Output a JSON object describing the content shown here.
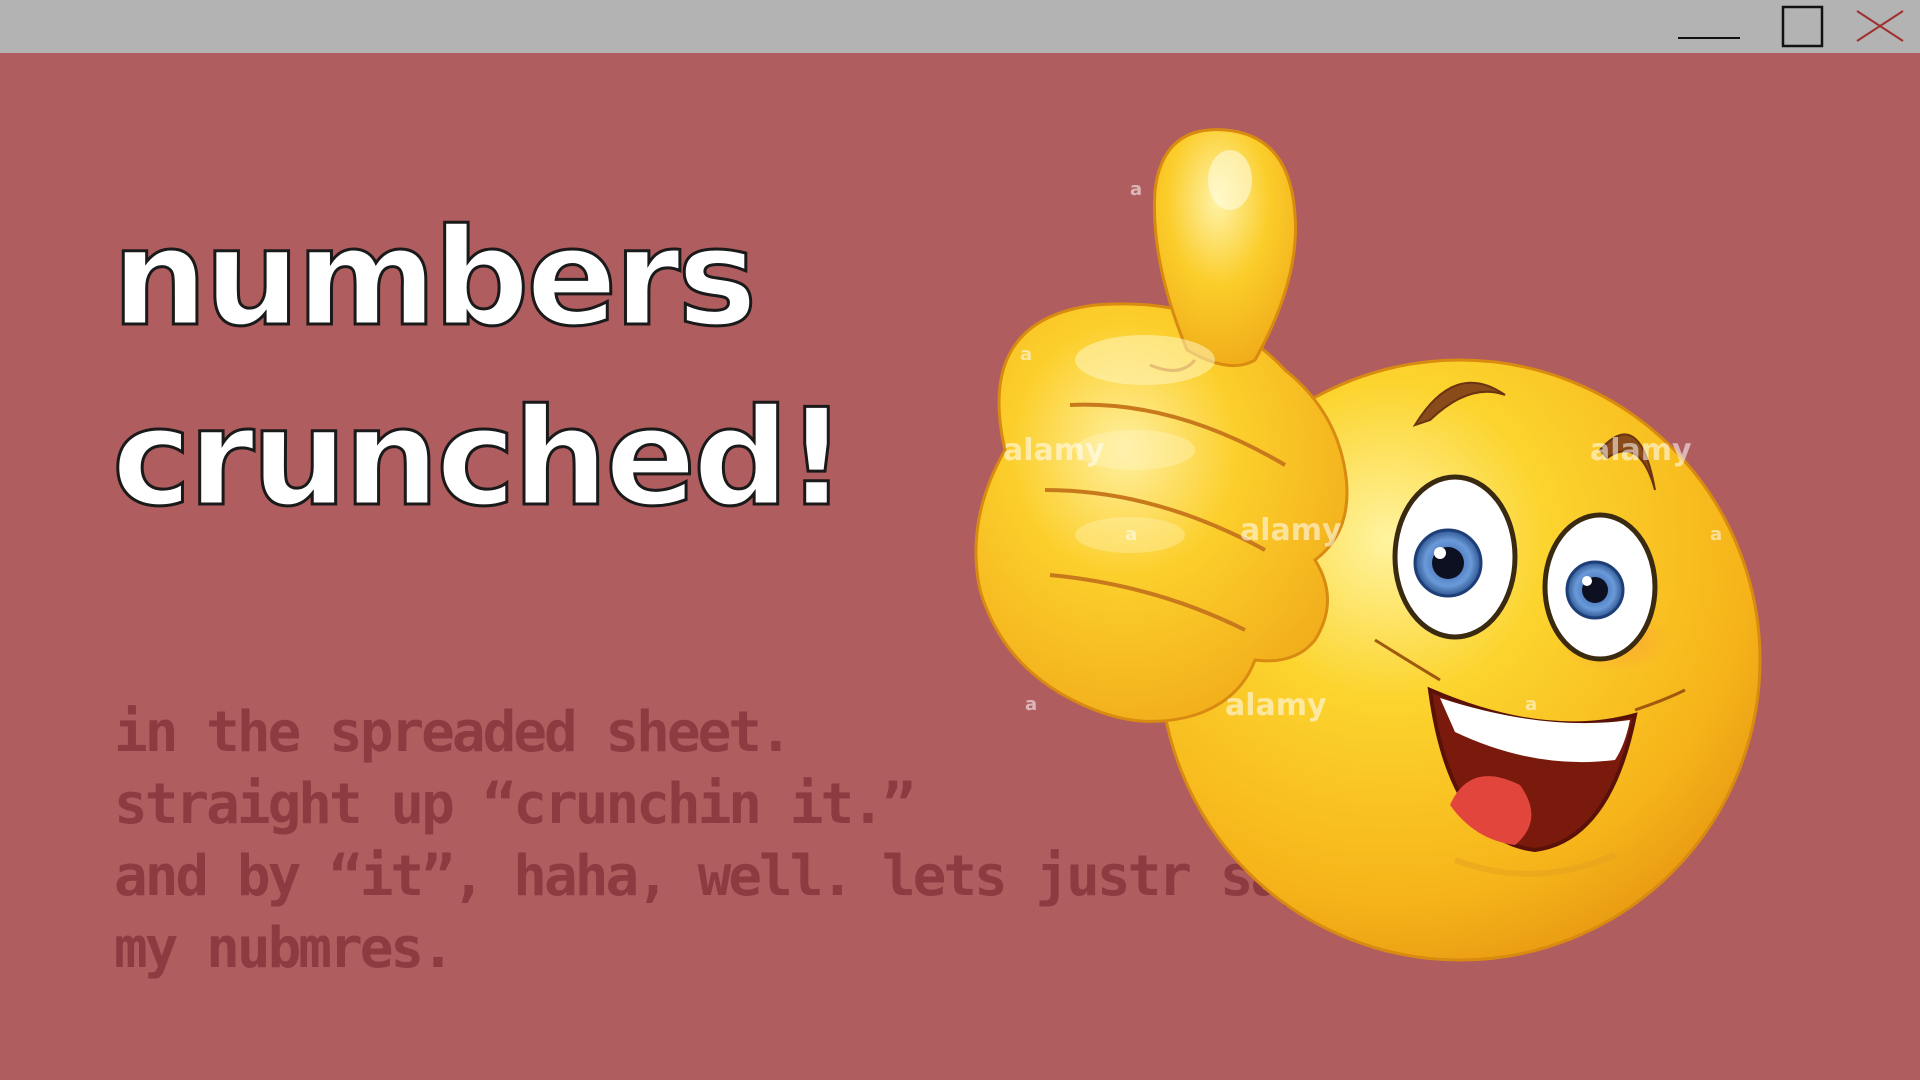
{
  "titlebar": {
    "minimize_icon": "minimize-icon",
    "maximize_icon": "maximize-icon",
    "close_icon": "close-icon"
  },
  "headline": {
    "line1": "numbers",
    "line2": "crunched!"
  },
  "body": {
    "lines": [
      "in the spreaded sheet.",
      "straight up “crunchin it.”",
      "and by “it”, haha, well. lets justr say.",
      "my nubmres."
    ]
  },
  "illustration": {
    "watermark": "alamy",
    "watermark_small": "a"
  },
  "colors": {
    "background": "#b05d60",
    "titlebar": "#b3b3b3",
    "close_x": "#a03030",
    "body_text": "#8c3c40",
    "emoji_yellow": "#f7c21a"
  }
}
